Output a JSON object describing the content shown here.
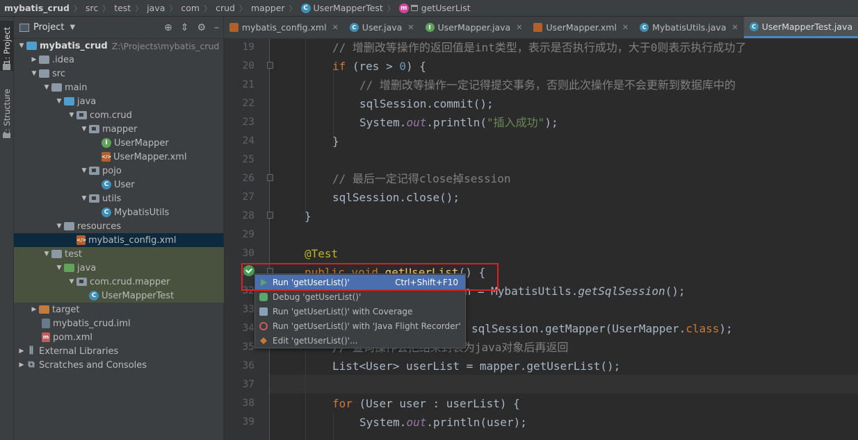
{
  "breadcrumb": {
    "items": [
      "mybatis_crud",
      "src",
      "test",
      "java",
      "com",
      "crud",
      "mapper",
      "UserMapperTest",
      "getUserList"
    ]
  },
  "sidebar_tabs": {
    "project": "1: Project",
    "structure": "Z: Structure"
  },
  "project_panel": {
    "title": "Project",
    "tree": [
      {
        "label": "mybatis_crud",
        "path": "Z:\\Projects\\mybatis_crud"
      },
      {
        "label": ".idea"
      },
      {
        "label": "src"
      },
      {
        "label": "main"
      },
      {
        "label": "java"
      },
      {
        "label": "com.crud"
      },
      {
        "label": "mapper"
      },
      {
        "label": "UserMapper"
      },
      {
        "label": "UserMapper.xml"
      },
      {
        "label": "pojo"
      },
      {
        "label": "User"
      },
      {
        "label": "utils"
      },
      {
        "label": "MybatisUtils"
      },
      {
        "label": "resources"
      },
      {
        "label": "mybatis_config.xml"
      },
      {
        "label": "test"
      },
      {
        "label": "java"
      },
      {
        "label": "com.crud.mapper"
      },
      {
        "label": "UserMapperTest"
      },
      {
        "label": "target"
      },
      {
        "label": "mybatis_crud.iml"
      },
      {
        "label": "pom.xml"
      },
      {
        "label": "External Libraries"
      },
      {
        "label": "Scratches and Consoles"
      }
    ]
  },
  "tabs": [
    {
      "label": "mybatis_config.xml"
    },
    {
      "label": "User.java"
    },
    {
      "label": "UserMapper.java"
    },
    {
      "label": "UserMapper.xml"
    },
    {
      "label": "MybatisUtils.java"
    },
    {
      "label": "UserMapperTest.java"
    }
  ],
  "line_numbers": [
    "19",
    "20",
    "21",
    "22",
    "23",
    "24",
    "25",
    "26",
    "27",
    "28",
    "29",
    "30",
    "31",
    "32",
    "33",
    "34",
    "35",
    "36",
    "37",
    "38",
    "39"
  ],
  "code": {
    "l19": "// 增删改等操作的返回值是int类型，表示是否执行成功，大于0则表示执行成功了",
    "l20a": "if",
    "l20b": " (res > ",
    "l20c": "0",
    "l20d": ") {",
    "l21": "// 增删改等操作一定记得提交事务，否则此次操作是不会更新到数据库中的",
    "l22": "sqlSession.commit();",
    "l23a": "System.",
    "l23b": "out",
    "l23c": ".println(",
    "l23d": "\"插入成功\"",
    "l23e": ");",
    "l24": "}",
    "l26": "// 最后一定记得close掉session",
    "l27": "sqlSession.close();",
    "l28": "}",
    "l30": "@Test",
    "l31a": "public void ",
    "l31b": "getUserList",
    "l31c": "() {",
    "l32a": "on = MybatisUtils.",
    "l32b": "getSqlSession",
    "l32c": "();",
    "l34a": "sqlSession.getMapper(UserMapper.",
    "l34b": "class",
    "l34c": ");",
    "l35": "// 查询操作会把结果封装为java对象后再返回",
    "l36": "List<User> userList = mapper.getUserList();",
    "l38a": "for",
    "l38b": " (User user : userList) {",
    "l39a": "System.",
    "l39b": "out",
    "l39c": ".println(user);"
  },
  "context_menu": {
    "items": [
      {
        "label": "Run 'getUserList()'",
        "shortcut": "Ctrl+Shift+F10"
      },
      {
        "label": "Debug 'getUserList()'"
      },
      {
        "label": "Run 'getUserList()' with Coverage"
      },
      {
        "label": "Run 'getUserList()' with 'Java Flight Recorder'"
      },
      {
        "label": "Edit 'getUserList()'..."
      }
    ]
  },
  "colors": {
    "background": "#2b2b2b",
    "keyword": "#cc7832",
    "comment": "#808080",
    "string": "#6a8759",
    "menu_highlight": "#4b6eaf",
    "annotation_box": "#e02020"
  }
}
